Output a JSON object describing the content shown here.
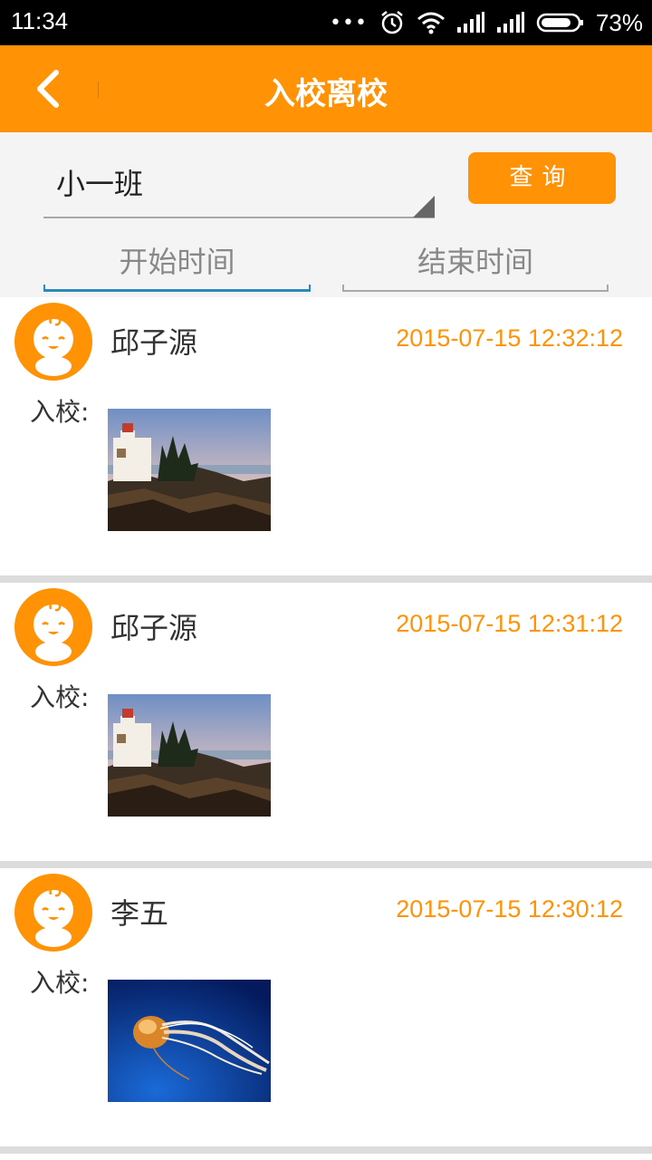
{
  "status_bar": {
    "time": "11:34",
    "dots": "•••",
    "battery_percent": "73%",
    "icons": [
      "alarm-icon",
      "wifi-icon",
      "signal-icon",
      "signal-icon",
      "battery-icon"
    ]
  },
  "app_bar": {
    "back_icon": "chevron-left-icon",
    "title": "入校离校",
    "color": "#ff9305"
  },
  "filter": {
    "class_value": "小一班",
    "query_label": "查询",
    "start_time_placeholder": "开始时间",
    "end_time_placeholder": "结束时间"
  },
  "records": [
    {
      "name": "邱子源",
      "time": "2015-07-15 12:32:12",
      "label": "入校:",
      "photo": "lighthouse-photo"
    },
    {
      "name": "邱子源",
      "time": "2015-07-15 12:31:12",
      "label": "入校:",
      "photo": "lighthouse-photo"
    },
    {
      "name": "李五",
      "time": "2015-07-15 12:30:12",
      "label": "入校:",
      "photo": "jellyfish-photo"
    }
  ],
  "colors": {
    "accent": "#ff9305",
    "time_text": "#ff9305",
    "focus_line": "#2a8ac0"
  }
}
